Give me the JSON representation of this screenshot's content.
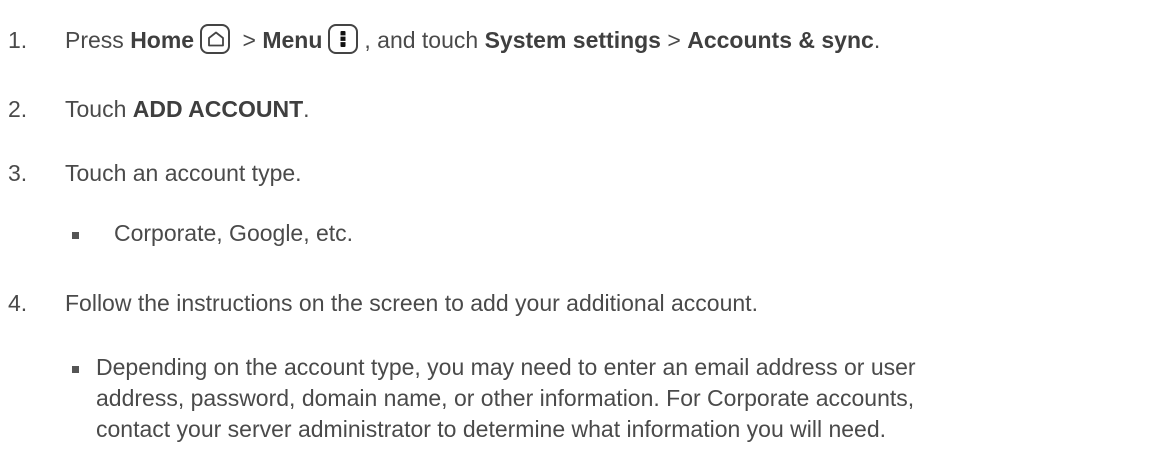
{
  "steps": [
    {
      "number": "1.",
      "parts": {
        "press": "Press ",
        "home": "Home",
        "sep1": " > ",
        "menu": "Menu",
        "mid": ", and touch ",
        "system_settings": "System settings",
        "sep2": " > ",
        "accounts_sync": "Accounts & sync",
        "end": "."
      },
      "icons": [
        "home-icon",
        "menu-icon"
      ]
    },
    {
      "number": "2.",
      "parts": {
        "touch": "Touch ",
        "add_account": "ADD ACCOUNT",
        "end": "."
      }
    },
    {
      "number": "3.",
      "text": "Touch an account type."
    },
    {
      "number": "4.",
      "text": "Follow the instructions on the screen to add your additional account."
    }
  ],
  "bullets": [
    {
      "text": "Corporate, Google, etc."
    },
    {
      "lines": [
        "Depending on the account type, you may need to enter an email address or user",
        "address, password, domain name, or other information. For Corporate accounts,",
        "contact your server administrator to determine what information you will need."
      ]
    }
  ]
}
